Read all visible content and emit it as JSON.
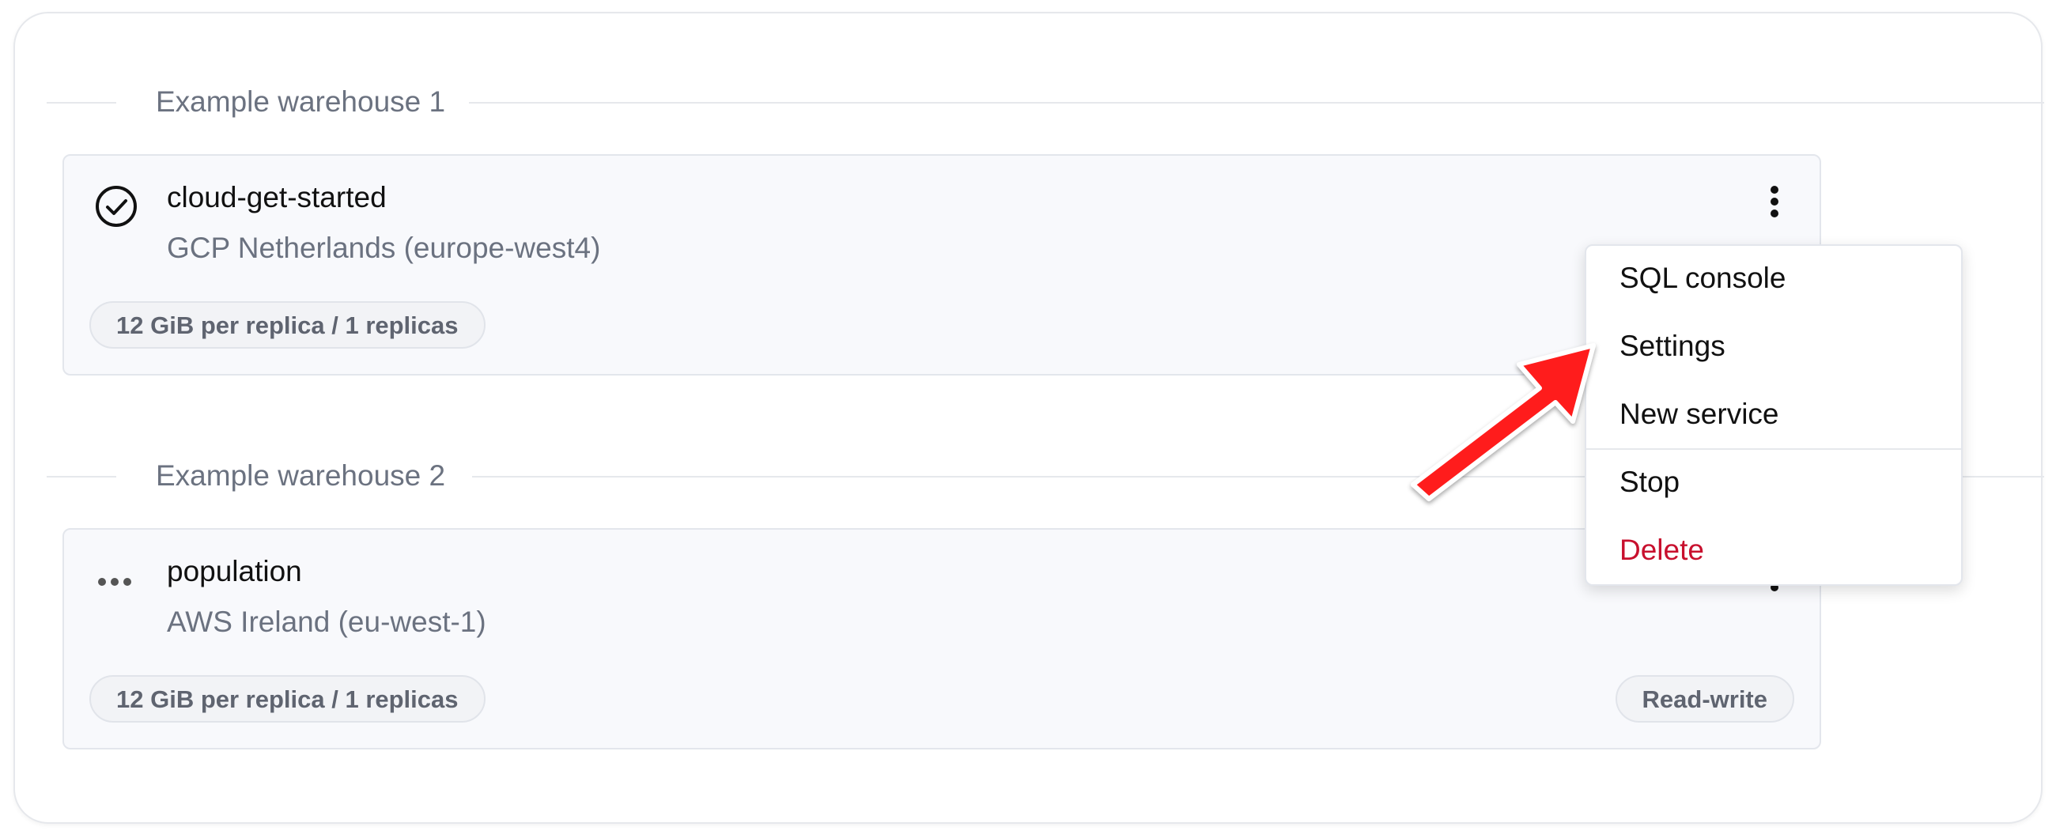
{
  "sections": [
    {
      "title": "Example warehouse 1",
      "service": {
        "name": "cloud-get-started",
        "region": "GCP Netherlands (europe-west4)",
        "status_icon": "check-circle-icon",
        "size_chip": "12 GiB per replica / 1 replicas"
      }
    },
    {
      "title": "Example warehouse 2",
      "service": {
        "name": "population",
        "region": "AWS Ireland (eu-west-1)",
        "status_icon": "more-horizontal-icon",
        "size_chip": "12 GiB per replica / 1 replicas",
        "mode_chip": "Read-write"
      }
    }
  ],
  "context_menu": {
    "items": [
      {
        "label": "SQL console"
      },
      {
        "label": "Settings"
      },
      {
        "label": "New service"
      },
      {
        "label": "Stop"
      },
      {
        "label": "Delete"
      }
    ]
  },
  "colors": {
    "danger": "#c8102e",
    "arrow": "#ff1a1a"
  },
  "annotation": {
    "icon": "red-arrow-pointing-to-settings"
  }
}
